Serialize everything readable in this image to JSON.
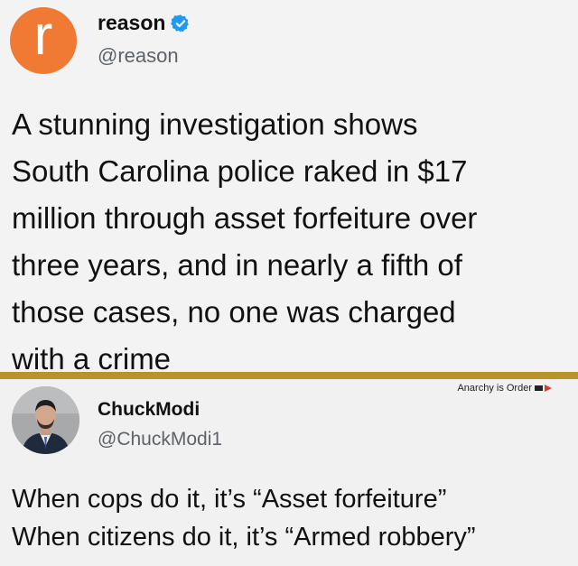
{
  "original_post": {
    "avatar_letter": "r",
    "avatar_color": "#f07a34",
    "display_name": "reason",
    "verified_icon": "verified-badge-icon",
    "verified_color": "#1d9bf0",
    "handle": "@reason",
    "text_lines": [
      "A stunning investigation shows",
      "South Carolina police raked in $17",
      "million through asset forfeiture over",
      "three years, and in nearly a fifth of",
      "those cases, no one was charged",
      "with a crime"
    ]
  },
  "divider_color": "#b8922a",
  "reply_post": {
    "display_name": "ChuckModi",
    "handle": "@ChuckModi1",
    "text_lines": [
      "When cops do it, it’s “Asset forfeiture”",
      "When citizens do it, it’s “Armed robbery”"
    ]
  },
  "watermark": {
    "text": "Anarchy is Order",
    "icon": "flag-icon"
  }
}
